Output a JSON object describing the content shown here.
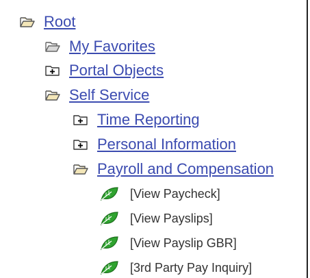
{
  "tree": {
    "root": {
      "label": "Root",
      "icon": "open-folder-icon"
    },
    "my_favorites": {
      "label": "My Favorites",
      "icon": "open-folder-icon"
    },
    "portal_objects": {
      "label": "Portal Objects",
      "icon": "collapsed-folder-icon"
    },
    "self_service": {
      "label": "Self Service",
      "icon": "open-folder-icon"
    },
    "time_reporting": {
      "label": "Time Reporting",
      "icon": "collapsed-folder-icon"
    },
    "personal_information": {
      "label": "Personal Information",
      "icon": "collapsed-folder-icon"
    },
    "payroll_compensation": {
      "label": "Payroll and Compensation",
      "icon": "open-folder-icon"
    },
    "leaves": [
      {
        "label": "[View Paycheck]",
        "icon": "leaf-icon"
      },
      {
        "label": "[View Payslips]",
        "icon": "leaf-icon"
      },
      {
        "label": "[View Payslip GBR]",
        "icon": "leaf-icon"
      },
      {
        "label": "[3rd Party Pay Inquiry]",
        "icon": "leaf-icon"
      }
    ]
  },
  "colors": {
    "link": "#3b4bb0",
    "leaf_text": "#333333",
    "folder_fill": "#f3e6b8",
    "folder_outline": "#555555",
    "leaf_green": "#2fa32f"
  }
}
